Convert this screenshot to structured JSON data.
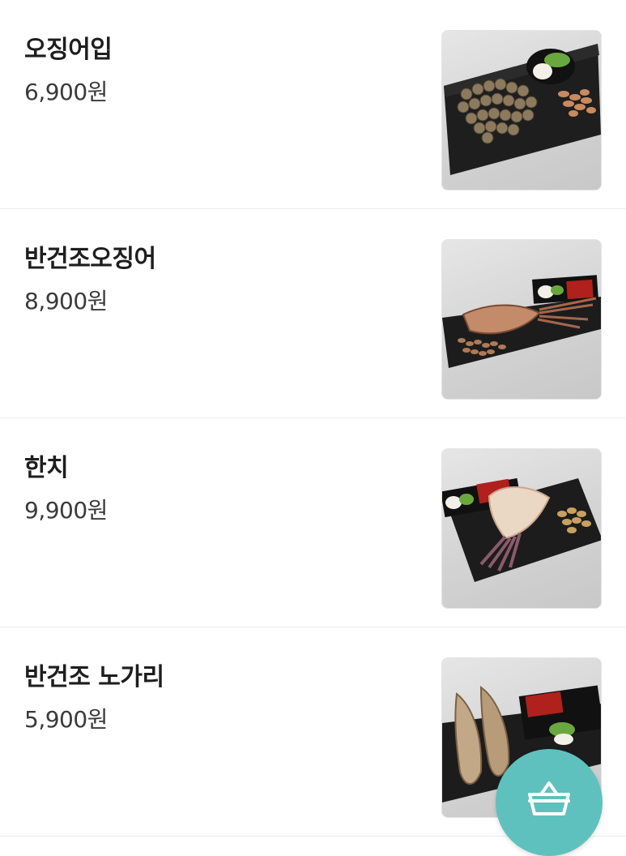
{
  "menu": {
    "items": [
      {
        "name": "오징어입",
        "price": "6,900원",
        "image": "squid-mouth-dish"
      },
      {
        "name": "반건조오징어",
        "price": "8,900원",
        "image": "half-dried-squid-dish"
      },
      {
        "name": "한치",
        "price": "9,900원",
        "image": "hanchi-squid-dish"
      },
      {
        "name": "반건조 노가리",
        "price": "5,900원",
        "image": "half-dried-pollack-dish"
      }
    ]
  },
  "cart_button": {
    "icon": "basket-icon"
  },
  "colors": {
    "accent": "#5fc1bd",
    "text_primary": "#1e1e1e",
    "text_secondary": "#3a3a3a",
    "divider": "#ececec"
  }
}
